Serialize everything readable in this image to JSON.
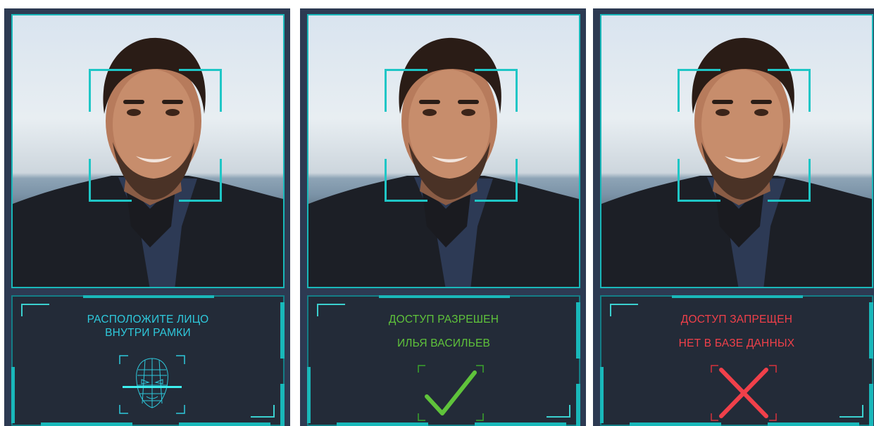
{
  "colors": {
    "accent": "#19b8ba",
    "panel_bg": "#2d3a52",
    "info_bg": "#232b38",
    "prompt": "#2ec9dc",
    "granted": "#5fc33b",
    "denied": "#f0404a"
  },
  "panels": [
    {
      "state": "scanning",
      "line1": "РАСПОЛОЖИТЕ ЛИЦО",
      "line2": "ВНУТРИ РАМКИ",
      "icon": "face-scan-icon"
    },
    {
      "state": "access-granted",
      "line1": "ДОСТУП РАЗРЕШЕН",
      "line2": "ИЛЬЯ ВАСИЛЬЕВ",
      "icon": "checkmark-icon"
    },
    {
      "state": "access-denied",
      "line1": "ДОСТУП ЗАПРЕЩЕН",
      "line2": "НЕТ В БАЗЕ ДАННЫХ",
      "icon": "cross-icon"
    }
  ]
}
